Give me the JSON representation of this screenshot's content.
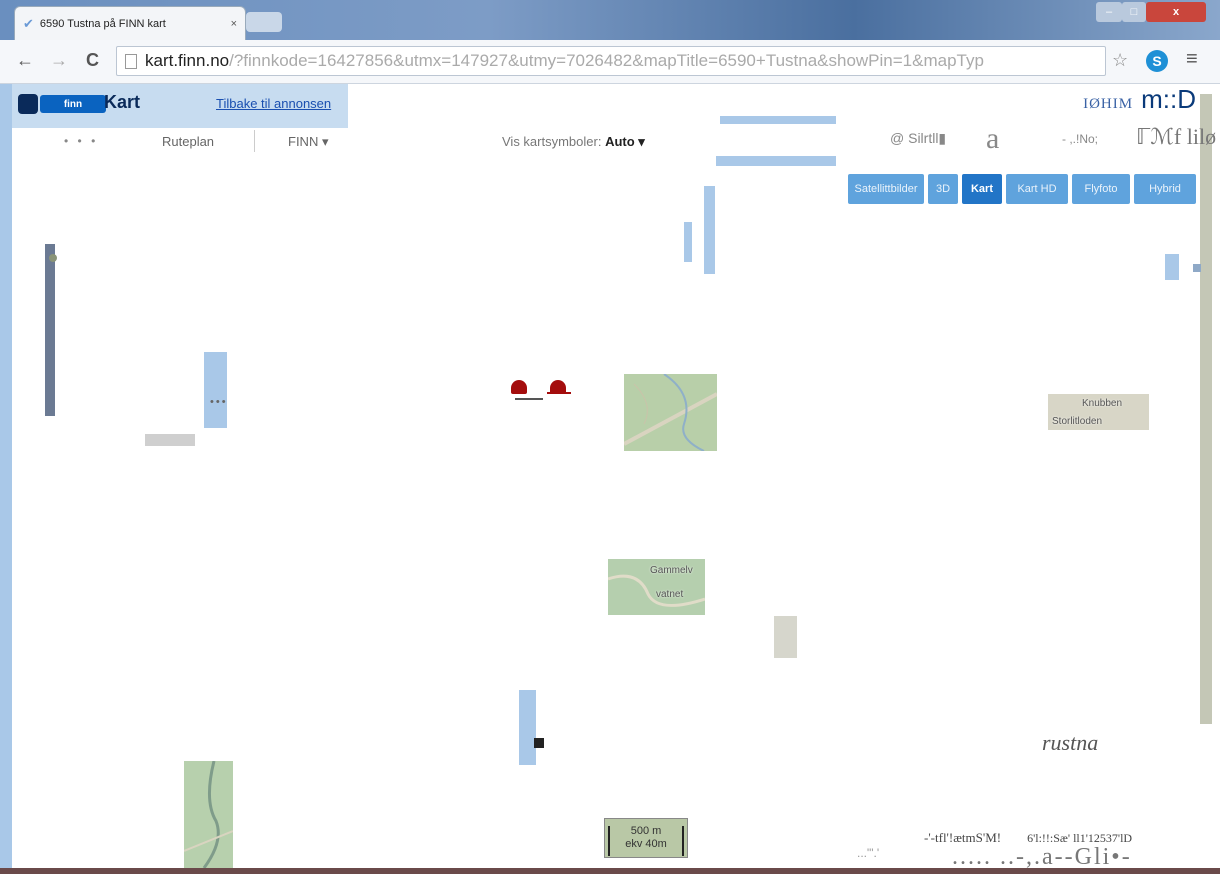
{
  "browser": {
    "tab_title": "6590 Tustna på FINN kart",
    "tab_close": "×",
    "url_host": "kart.finn.no",
    "url_rest": "/?finnkode=16427856&utmx=147927&utmy=7026482&mapTitle=6590+Tustna&showPin=1&mapTyp",
    "back_icon": "←",
    "forward_icon": "→",
    "reload_icon": "C",
    "star_icon": "☆",
    "menu_icon": "≡",
    "extension_label": "S"
  },
  "header": {
    "logo_text": "finn",
    "title": "Kart",
    "back_link": "Tilbake til annonsen",
    "brand_right_small": "IØHIM",
    "brand_right_large": "m::D"
  },
  "nav": {
    "dots": "• • •",
    "ruteplan": "Ruteplan",
    "finn_menu": "FINN ▾",
    "symbols_label": "Vis kartsymboler:",
    "symbols_value": "Auto ▾"
  },
  "search_row": {
    "item1": "@ Silrtll▮",
    "item2": "a",
    "item3": "- ,.!No;",
    "item4": "ℾℳf lilø"
  },
  "map_types": [
    {
      "label": "Satellittbilder",
      "active": false
    },
    {
      "label": "3D",
      "active": false
    },
    {
      "label": "Kart",
      "active": true
    },
    {
      "label": "Kart HD",
      "active": false
    },
    {
      "label": "Flyfoto",
      "active": false
    },
    {
      "label": "Hybrid",
      "active": false
    }
  ],
  "map_labels": {
    "knubben": "Knubben",
    "storlitloden": "Storlitloden",
    "gammelv": "Gammelv",
    "vatnet": "vatnet",
    "rustna": "rustna"
  },
  "scale": {
    "line1": "500 m",
    "line2": "ekv 40m"
  },
  "footer": {
    "copyright_1": "-'-tfl'!ætmS'M!",
    "copyright_2": "6'l:!!:Sæ' ll1'12537'lD",
    "garble": "..... ..-,.a--Gli•-",
    "dots": "...\"'.'"
  }
}
